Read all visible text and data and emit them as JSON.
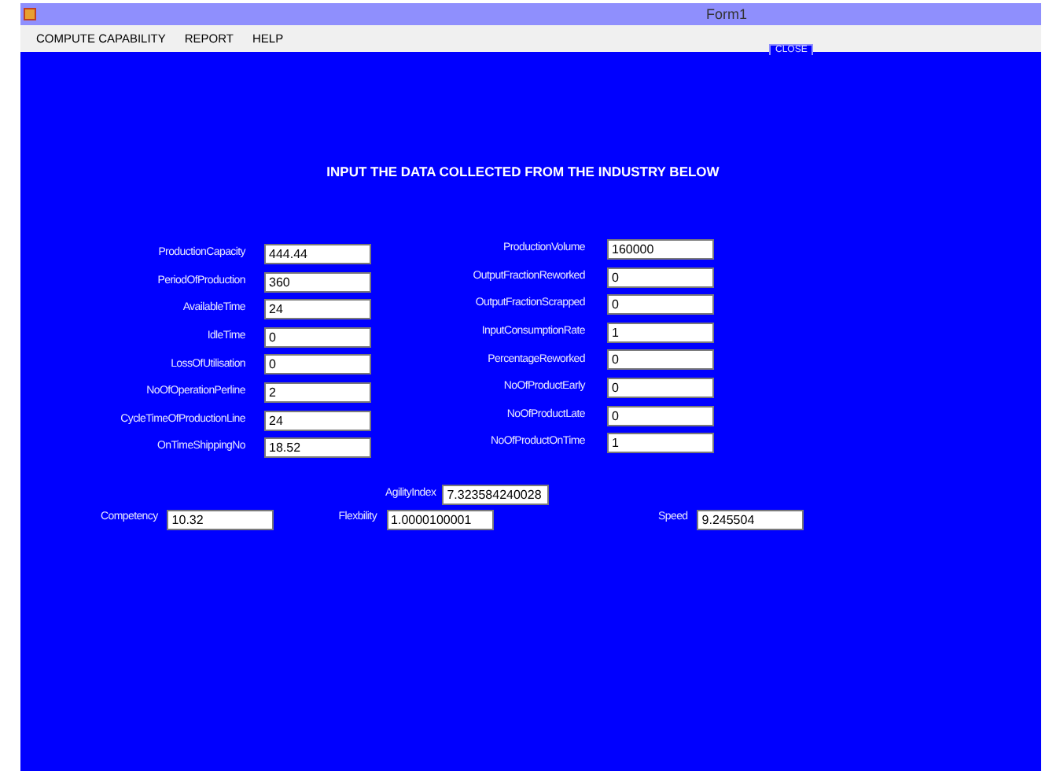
{
  "window": {
    "title": "Form1"
  },
  "menu": [
    "COMPUTE CAPABILITY",
    "REPORT",
    "HELP"
  ],
  "close_button": "CLOSE",
  "heading": "INPUT THE DATA COLLECTED FROM THE INDUSTRY BELOW",
  "left_fields": [
    {
      "label": "ProductionCapacity",
      "value": "444.44"
    },
    {
      "label": "PeriodOfProduction",
      "value": "360"
    },
    {
      "label": "AvailableTime",
      "value": "24"
    },
    {
      "label": "IdleTime",
      "value": "0"
    },
    {
      "label": "LossOfUtilisation",
      "value": "0"
    },
    {
      "label": "NoOfOperationPerline",
      "value": "2"
    },
    {
      "label": "CycleTimeOfProductionLine",
      "value": "24"
    },
    {
      "label": "OnTimeShippingNo",
      "value": "18.52"
    }
  ],
  "right_fields": [
    {
      "label": "ProductionVolume",
      "value": "160000"
    },
    {
      "label": "OutputFractionReworked",
      "value": "0"
    },
    {
      "label": "OutputFractionScrapped",
      "value": "0"
    },
    {
      "label": "InputConsumptionRate",
      "value": "1"
    },
    {
      "label": "PercentageReworked",
      "value": "0"
    },
    {
      "label": "NoOfProductEarly",
      "value": "0"
    },
    {
      "label": "NoOfProductLate",
      "value": "0"
    },
    {
      "label": "NoOfProductOnTime",
      "value": "1"
    }
  ],
  "agility": {
    "label": "AgilityIndex",
    "value": "7.323584240028"
  },
  "metrics": [
    {
      "label": "Competency",
      "value": "10.32"
    },
    {
      "label": "Flexbility",
      "value": "1.0000100001"
    },
    {
      "label": "Speed",
      "value": "9.245504"
    }
  ]
}
